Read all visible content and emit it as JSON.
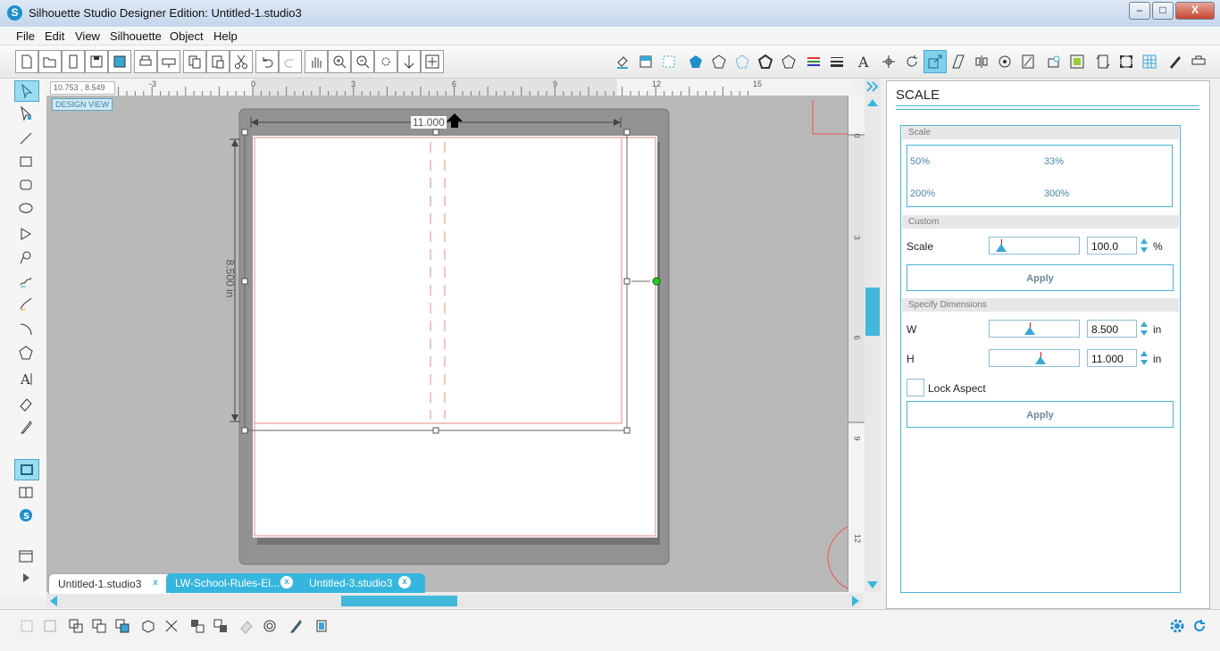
{
  "window": {
    "title": "Silhouette Studio Designer Edition: Untitled-1.studio3",
    "logo_letter": "S",
    "minimize": "–",
    "maximize": "□",
    "close": "X"
  },
  "menu": [
    "File",
    "Edit",
    "View",
    "Silhouette",
    "Object",
    "Help"
  ],
  "ruler": {
    "h_ticks": [
      "-3",
      "0",
      "3",
      "6",
      "9",
      "12",
      "15"
    ],
    "v_ticks": [
      "0",
      "3",
      "6",
      "9",
      "12"
    ],
    "coords": "10.753 , 8.549"
  },
  "canvas": {
    "view_label": "DESIGN VIEW",
    "width_label": "11.000",
    "height_label": "8.500 in"
  },
  "tabs": [
    {
      "label": "Untitled-1.studio3",
      "close": "x"
    },
    {
      "label": "LW-School-Rules-El...",
      "close": "x"
    },
    {
      "label": "Untitled-3.studio3",
      "close": "x"
    }
  ],
  "panel": {
    "title": "SCALE",
    "scale_section": "Scale",
    "presets": [
      "50%",
      "33%",
      "200%",
      "300%"
    ],
    "custom_section": "Custom",
    "scale_label": "Scale",
    "scale_value": "100.0",
    "scale_unit": "%",
    "apply_label": "Apply",
    "dims_section": "Specify Dimensions",
    "w_label": "W",
    "w_value": "8.500",
    "h_label": "H",
    "h_value": "11.000",
    "dim_unit": "in",
    "lock_label": "Lock Aspect",
    "apply2_label": "Apply"
  },
  "colors": {
    "accent": "#36b6df",
    "cut_line": "#e88a8a",
    "handle_green": "#22cc22"
  }
}
